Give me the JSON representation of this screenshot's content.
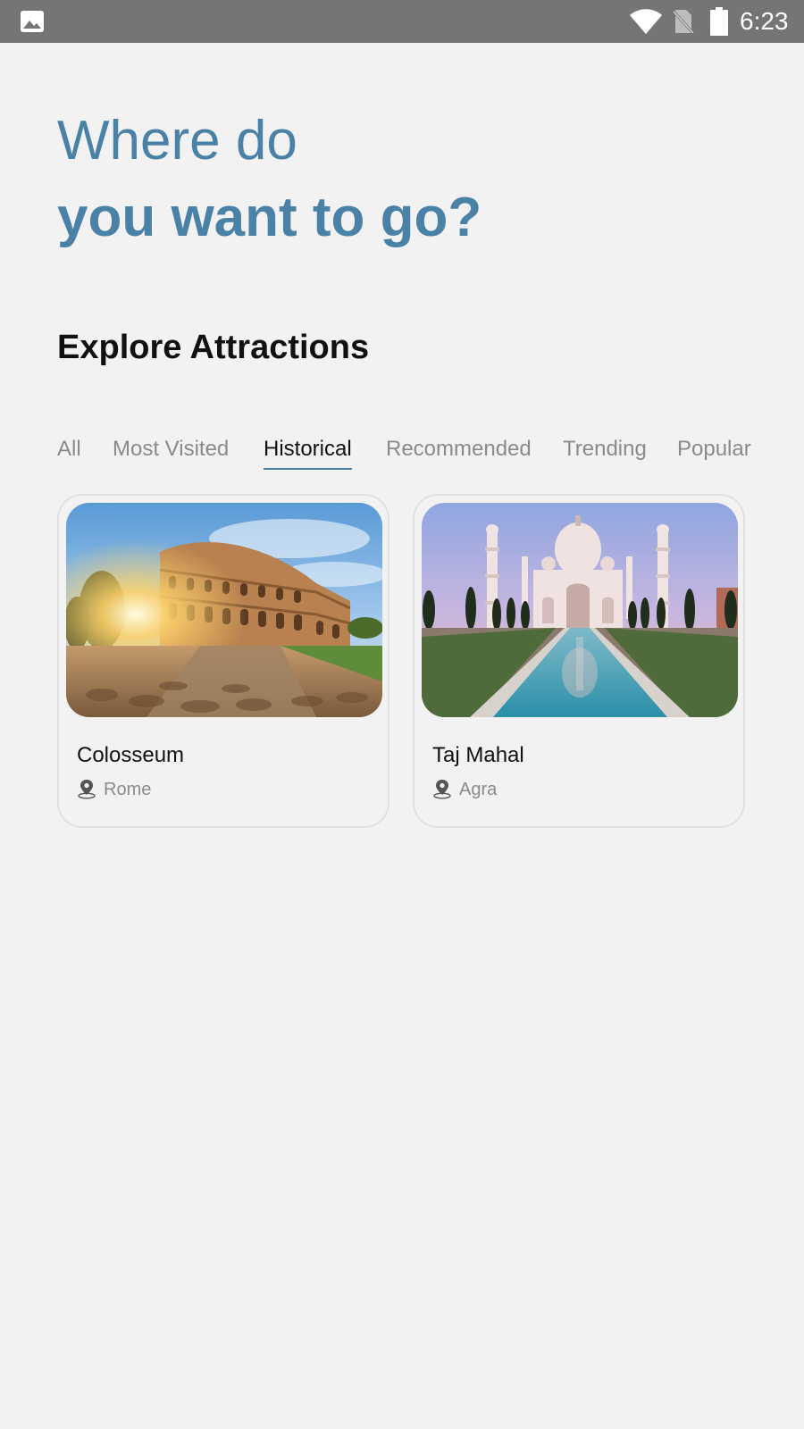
{
  "status_bar": {
    "time": "6:23",
    "icons": [
      "gallery-icon",
      "wifi-icon",
      "no-sim-icon",
      "battery-icon"
    ]
  },
  "header": {
    "line1": "Where do",
    "line2": "you want to go?",
    "accent_color": "#4a81a6"
  },
  "section": {
    "title": "Explore Attractions"
  },
  "tabs": [
    {
      "label": "All",
      "active": false
    },
    {
      "label": "Most Visited",
      "active": false
    },
    {
      "label": "Historical",
      "active": true
    },
    {
      "label": "Recommended",
      "active": false
    },
    {
      "label": "Trending",
      "active": false
    },
    {
      "label": "Popular",
      "active": false
    }
  ],
  "attractions": [
    {
      "name": "Colosseum",
      "location": "Rome",
      "image": "colosseum-photo",
      "icon": "location-pin-icon"
    },
    {
      "name": "Taj Mahal",
      "location": "Agra",
      "image": "taj-mahal-photo",
      "icon": "location-pin-icon"
    }
  ]
}
